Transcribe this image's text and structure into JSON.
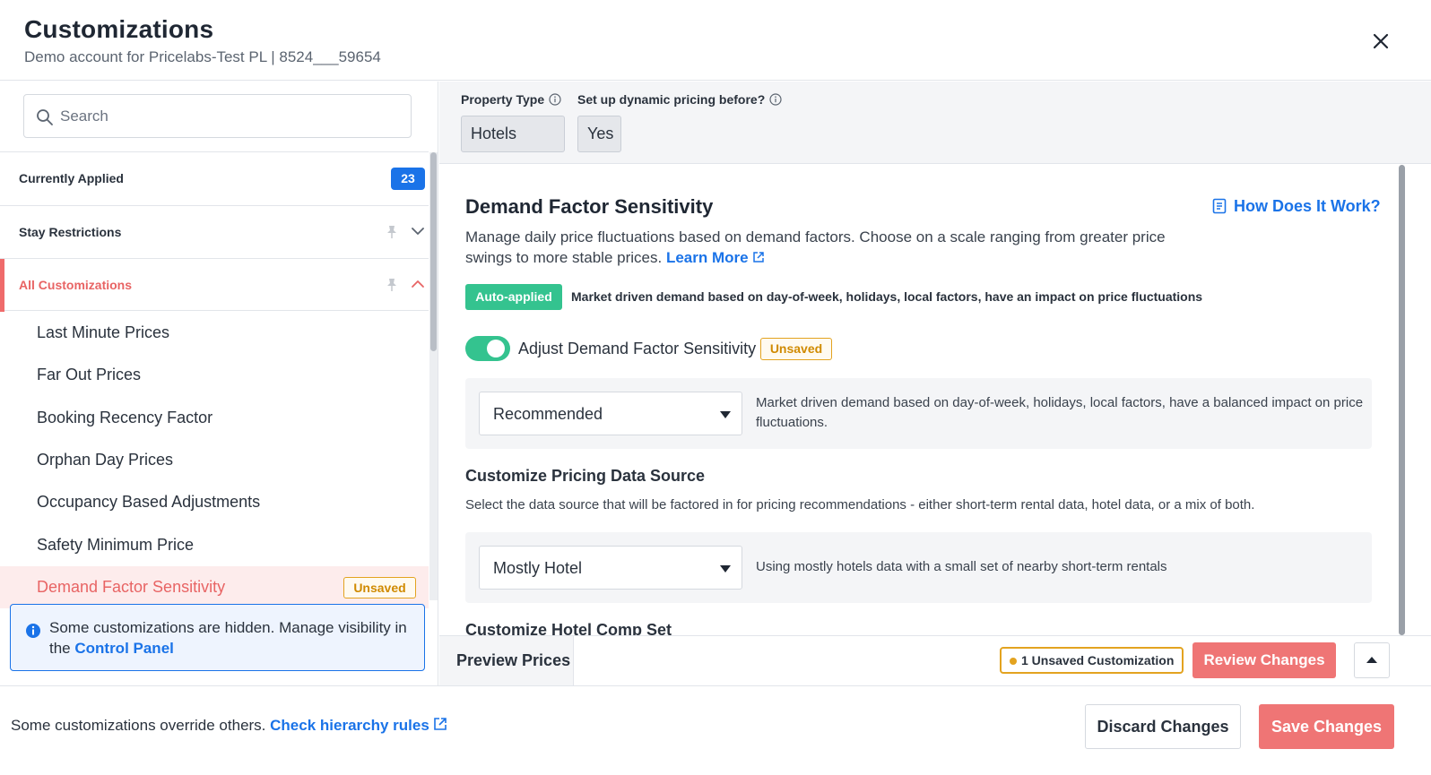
{
  "header": {
    "title": "Customizations",
    "subtitle": "Demo account for Pricelabs-Test PL | 8524___59654"
  },
  "sidebar": {
    "search_placeholder": "Search",
    "currently_applied": {
      "label": "Currently Applied",
      "count": "23"
    },
    "stay_restrictions": {
      "label": "Stay Restrictions"
    },
    "all_customizations": {
      "label": "All Customizations"
    },
    "items": [
      {
        "label": "Last Minute Prices"
      },
      {
        "label": "Far Out Prices"
      },
      {
        "label": "Booking Recency Factor"
      },
      {
        "label": "Orphan Day Prices"
      },
      {
        "label": "Occupancy Based Adjustments"
      },
      {
        "label": "Safety Minimum Price"
      },
      {
        "label": "Demand Factor Sensitivity",
        "tag": "Unsaved"
      }
    ],
    "info": {
      "text": "Some customizations are hidden. Manage visibility in the ",
      "link": "Control Panel"
    }
  },
  "property": {
    "type_label": "Property Type",
    "type_value": "Hotels",
    "dynamic_label": "Set up dynamic pricing before?",
    "dynamic_value": "Yes"
  },
  "content": {
    "title": "Demand Factor Sensitivity",
    "how_link": "How Does It Work?",
    "description": "Manage daily price fluctuations based on demand factors. Choose on a scale ranging from greater price swings to more stable prices.",
    "learn_more": "Learn More",
    "auto_badge": "Auto-applied",
    "auto_text": "Market driven demand based on day-of-week, holidays, local factors, have an impact on price fluctuations",
    "toggle_label": "Adjust Demand Factor Sensitivity",
    "toggle_on": true,
    "unsaved_tag": "Unsaved",
    "sensitivity_select": "Recommended",
    "sensitivity_desc": "Market driven demand based on day-of-week, holidays, local factors, have a balanced impact on price fluctuations.",
    "data_source_title": "Customize Pricing Data Source",
    "data_source_desc": "Select the data source that will be factored in for pricing recommendations - either short-term rental data, hotel data, or a mix of both.",
    "data_source_select": "Mostly Hotel",
    "data_source_option_desc": "Using mostly hotels data with a small set of nearby short-term rentals",
    "comp_set_title": "Customize Hotel Comp Set"
  },
  "preview_bar": {
    "preview_label": "Preview Prices",
    "unsaved_count": "1 Unsaved Customization",
    "review_button": "Review Changes"
  },
  "footer": {
    "text": "Some customizations override others.",
    "link": "Check hierarchy rules",
    "discard_button": "Discard Changes",
    "save_button": "Save Changes"
  },
  "colors": {
    "primary_blue": "#1a73e8",
    "accent_red": "#ef7575",
    "success_green": "#34c38f",
    "warning_amber": "#e3a320"
  }
}
